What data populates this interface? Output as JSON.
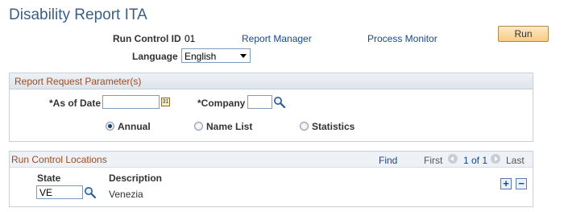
{
  "page": {
    "title": "Disability Report ITA"
  },
  "header": {
    "run_control_label": "Run Control ID",
    "run_control_value": "01",
    "report_manager": "Report Manager",
    "process_monitor": "Process Monitor",
    "run_label": "Run",
    "language_label": "Language",
    "language_value": "English"
  },
  "params": {
    "title": "Report Request Parameter(s)",
    "as_of_date_label": "*As of Date",
    "as_of_date_value": "",
    "company_label": "*Company",
    "company_value": "",
    "options": [
      {
        "label": "Annual",
        "selected": true
      },
      {
        "label": "Name List",
        "selected": false
      },
      {
        "label": "Statistics",
        "selected": false
      }
    ]
  },
  "locations": {
    "title": "Run Control Locations",
    "find": "Find",
    "first": "First",
    "range": "1 of 1",
    "last": "Last",
    "columns": {
      "state": "State",
      "description": "Description"
    },
    "rows": [
      {
        "state": "VE",
        "description": "Venezia"
      }
    ]
  }
}
